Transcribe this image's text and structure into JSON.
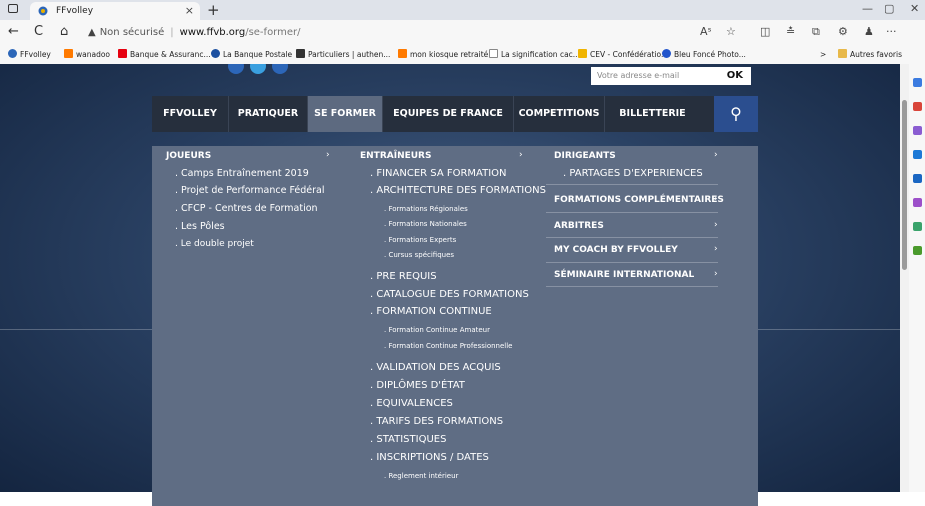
{
  "browser": {
    "tab_title": "FFvolley",
    "tab_close": "×",
    "new_tab": "+",
    "window_min": "—",
    "window_max": "▢",
    "window_close": "✕",
    "address": {
      "security_label": "Non sécurisé",
      "host": "www.ffvb.org",
      "path": "/se-former/"
    },
    "nav": {
      "back": "←",
      "refresh": "C",
      "home": "⌂"
    },
    "toolbar": {
      "read": "Aˢ",
      "fav": "☆",
      "split": "◫",
      "favorites": "≛",
      "collections": "⧉",
      "ext": "⚙",
      "profile": "♟",
      "more": "···"
    },
    "bookmarks": [
      {
        "label": "FFvolley",
        "color": "#2c66b8"
      },
      {
        "label": "wanadoo",
        "color": "#ff7a00"
      },
      {
        "label": "Banque & Assuranc...",
        "color": "#e6000f"
      },
      {
        "label": "La Banque Postale",
        "color": "#1b4fa0"
      },
      {
        "label": "Particuliers | authen...",
        "color": "#333333"
      },
      {
        "label": "mon kiosque retraité",
        "color": "#ff7a00"
      },
      {
        "label": "La signification cac...",
        "color": "#888888"
      },
      {
        "label": "CEV - Confédératio...",
        "color": "#f0b400"
      },
      {
        "label": "Bleu Foncé Photo...",
        "color": "#2255cc"
      }
    ],
    "bookmarks_more": ">",
    "other_favorites": "Autres favoris"
  },
  "site": {
    "email_placeholder": "Votre adresse e-mail",
    "email_ok": "OK",
    "nav": [
      {
        "label": "FFVOLLEY",
        "active": false
      },
      {
        "label": "PRATIQUER",
        "active": false
      },
      {
        "label": "SE FORMER",
        "active": true
      },
      {
        "label": "EQUIPES DE FRANCE",
        "active": false
      },
      {
        "label": "COMPETITIONS",
        "active": false
      },
      {
        "label": "BILLETTERIE",
        "active": false
      }
    ],
    "search_icon": "⚲",
    "menu": {
      "chevron": "›",
      "joueurs": {
        "title": "JOUEURS",
        "items": [
          "Camps Entraînement 2019",
          "Projet de Performance Fédéral",
          "CFCP - Centres de Formation",
          "Les Pôles",
          "Le double projet"
        ]
      },
      "entraineurs": {
        "title": "ENTRAÎNEURS",
        "financer": "FINANCER SA FORMATION",
        "architecture": "ARCHITECTURE DES FORMATIONS",
        "architecture_sub": [
          "Formations Régionales",
          "Formations Nationales",
          "Formations Experts",
          "Cursus spécifiques"
        ],
        "pre_requis": "PRE REQUIS",
        "catalogue": "CATALOGUE DES FORMATIONS",
        "continue": "FORMATION CONTINUE",
        "continue_sub": [
          "Formation Continue Amateur",
          "Formation Continue Professionnelle"
        ],
        "others": [
          "VALIDATION DES ACQUIS",
          "DIPLÔMES D'ÉTAT",
          "EQUIVALENCES",
          "TARIFS DES FORMATIONS",
          "STATISTIQUES",
          "INSCRIPTIONS / DATES"
        ],
        "inscriptions_sub": "Reglement intérieur"
      },
      "dirigeants": {
        "title": "DIRIGEANTS",
        "sub": "PARTAGES D'EXPERIENCES"
      },
      "right_links": [
        "FORMATIONS COMPLÉMENTAIRES",
        "ARBITRES",
        "MY COACH BY FFVOLLEY",
        "SÉMINAIRE INTERNATIONAL"
      ]
    }
  }
}
